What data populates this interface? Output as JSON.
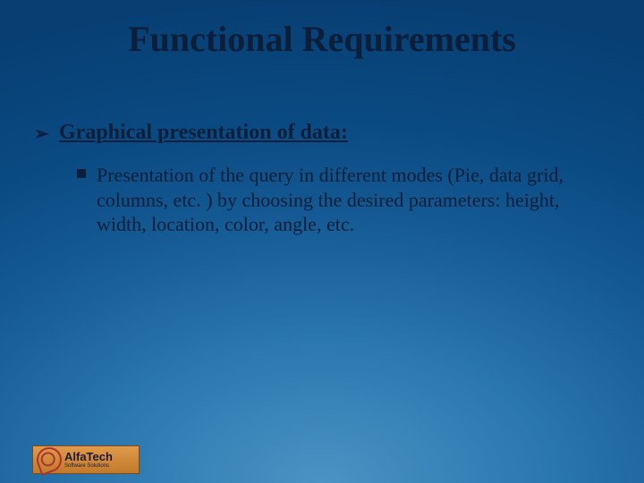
{
  "title": "Functional Requirements",
  "bullet1": {
    "marker": "➢",
    "text": "Graphical presentation of data:"
  },
  "bullet2": {
    "text": "Presentation of the query in different modes (Pie, data grid, columns, etc. ) by choosing the desired parameters: height, width, location, color, angle, etc."
  },
  "logo": {
    "name": "AlfaTech",
    "tagline": "Software Solutions"
  }
}
